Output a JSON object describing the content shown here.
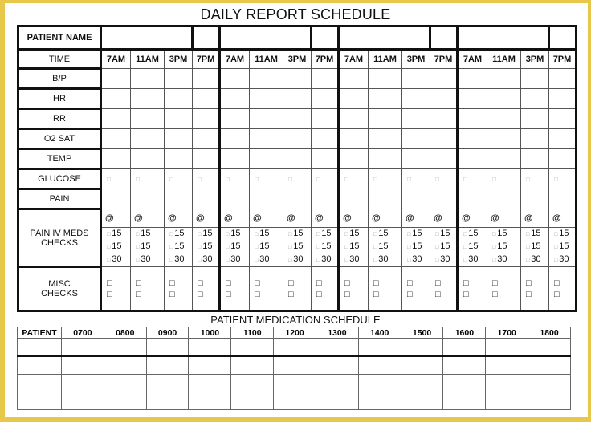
{
  "daily_report": {
    "title": "DAILY REPORT SCHEDULE",
    "patient_name_label": "PATIENT NAME",
    "time_label": "TIME",
    "groups": 4,
    "times": [
      "7AM",
      "11AM",
      "3PM",
      "7PM"
    ],
    "rows": [
      "B/P",
      "HR",
      "RR",
      "O2 SAT",
      "TEMP",
      "GLUCOSE",
      "PAIN"
    ],
    "checkbox_glyph": "□",
    "pain_iv_label_line1": "PAIN IV MEDS",
    "pain_iv_label_line2": "CHECKS",
    "at_symbol": "@",
    "iv_checks": [
      "15",
      "15",
      "30"
    ],
    "misc_label_line1": "MISC",
    "misc_label_line2": "CHECKS"
  },
  "medication_schedule": {
    "title": "PATIENT MEDICATION SCHEDULE",
    "headers": [
      "PATIENT",
      "0700",
      "0800",
      "0900",
      "1000",
      "1100",
      "1200",
      "1300",
      "1400",
      "1500",
      "1600",
      "1700",
      "1800"
    ],
    "row_count": 4
  }
}
